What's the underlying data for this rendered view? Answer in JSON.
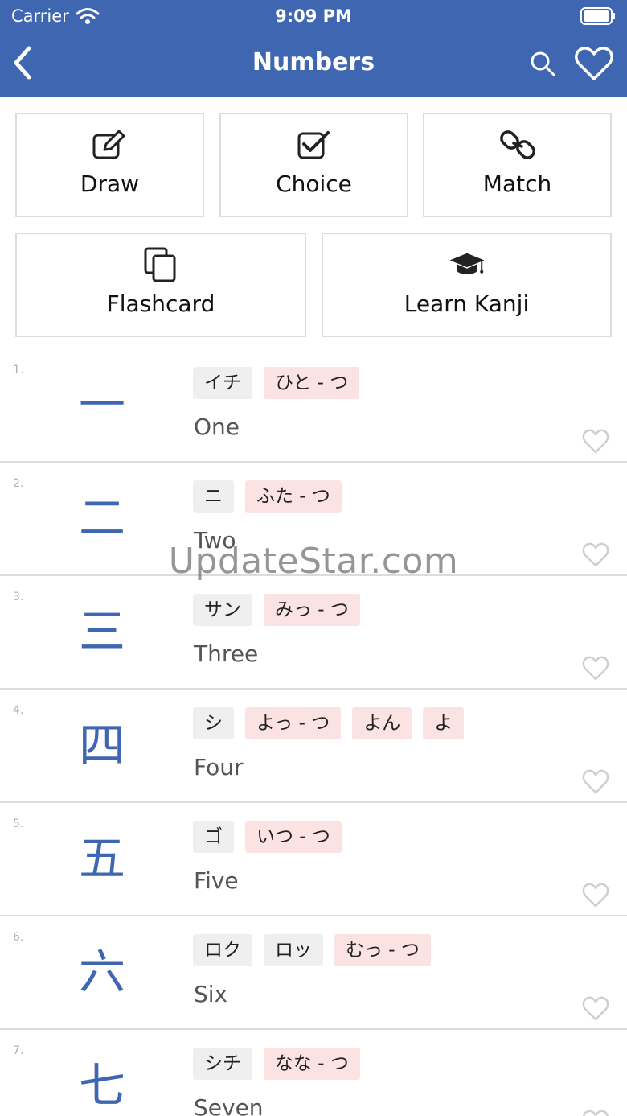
{
  "status_bar": {
    "carrier": "Carrier",
    "time": "9:09 PM"
  },
  "nav": {
    "title": "Numbers",
    "back_icon": "chevron-left-icon",
    "search_icon": "search-icon",
    "favorite_icon": "heart-outline-icon"
  },
  "modes": {
    "draw": "Draw",
    "choice": "Choice",
    "match": "Match",
    "flashcard": "Flashcard",
    "learn_kanji": "Learn Kanji"
  },
  "kanji_list": [
    {
      "number": "1.",
      "kanji": "一",
      "on": [
        "イチ"
      ],
      "kun": [
        "ひと - つ"
      ],
      "extra": [],
      "meaning": "One"
    },
    {
      "number": "2.",
      "kanji": "二",
      "on": [
        "ニ"
      ],
      "kun": [
        "ふた - つ"
      ],
      "extra": [],
      "meaning": "Two"
    },
    {
      "number": "3.",
      "kanji": "三",
      "on": [
        "サン"
      ],
      "kun": [
        "みっ - つ"
      ],
      "extra": [],
      "meaning": "Three"
    },
    {
      "number": "4.",
      "kanji": "四",
      "on": [
        "シ"
      ],
      "kun": [
        "よっ - つ",
        "よん",
        "よ"
      ],
      "extra": [],
      "meaning": "Four"
    },
    {
      "number": "5.",
      "kanji": "五",
      "on": [
        "ゴ"
      ],
      "kun": [
        "いつ - つ"
      ],
      "extra": [],
      "meaning": "Five"
    },
    {
      "number": "6.",
      "kanji": "六",
      "on": [
        "ロク",
        "ロッ"
      ],
      "kun": [
        "むっ - つ"
      ],
      "extra": [],
      "meaning": "Six"
    },
    {
      "number": "7.",
      "kanji": "七",
      "on": [
        "シチ"
      ],
      "kun": [
        "なな - つ"
      ],
      "extra": [],
      "meaning": "Seven"
    }
  ],
  "watermark": "UpdateStar.com",
  "colors": {
    "primary": "#3f66b0",
    "on_chip": "#efefef",
    "kun_chip": "#fbe3e3",
    "divider": "#dcdcdc"
  }
}
